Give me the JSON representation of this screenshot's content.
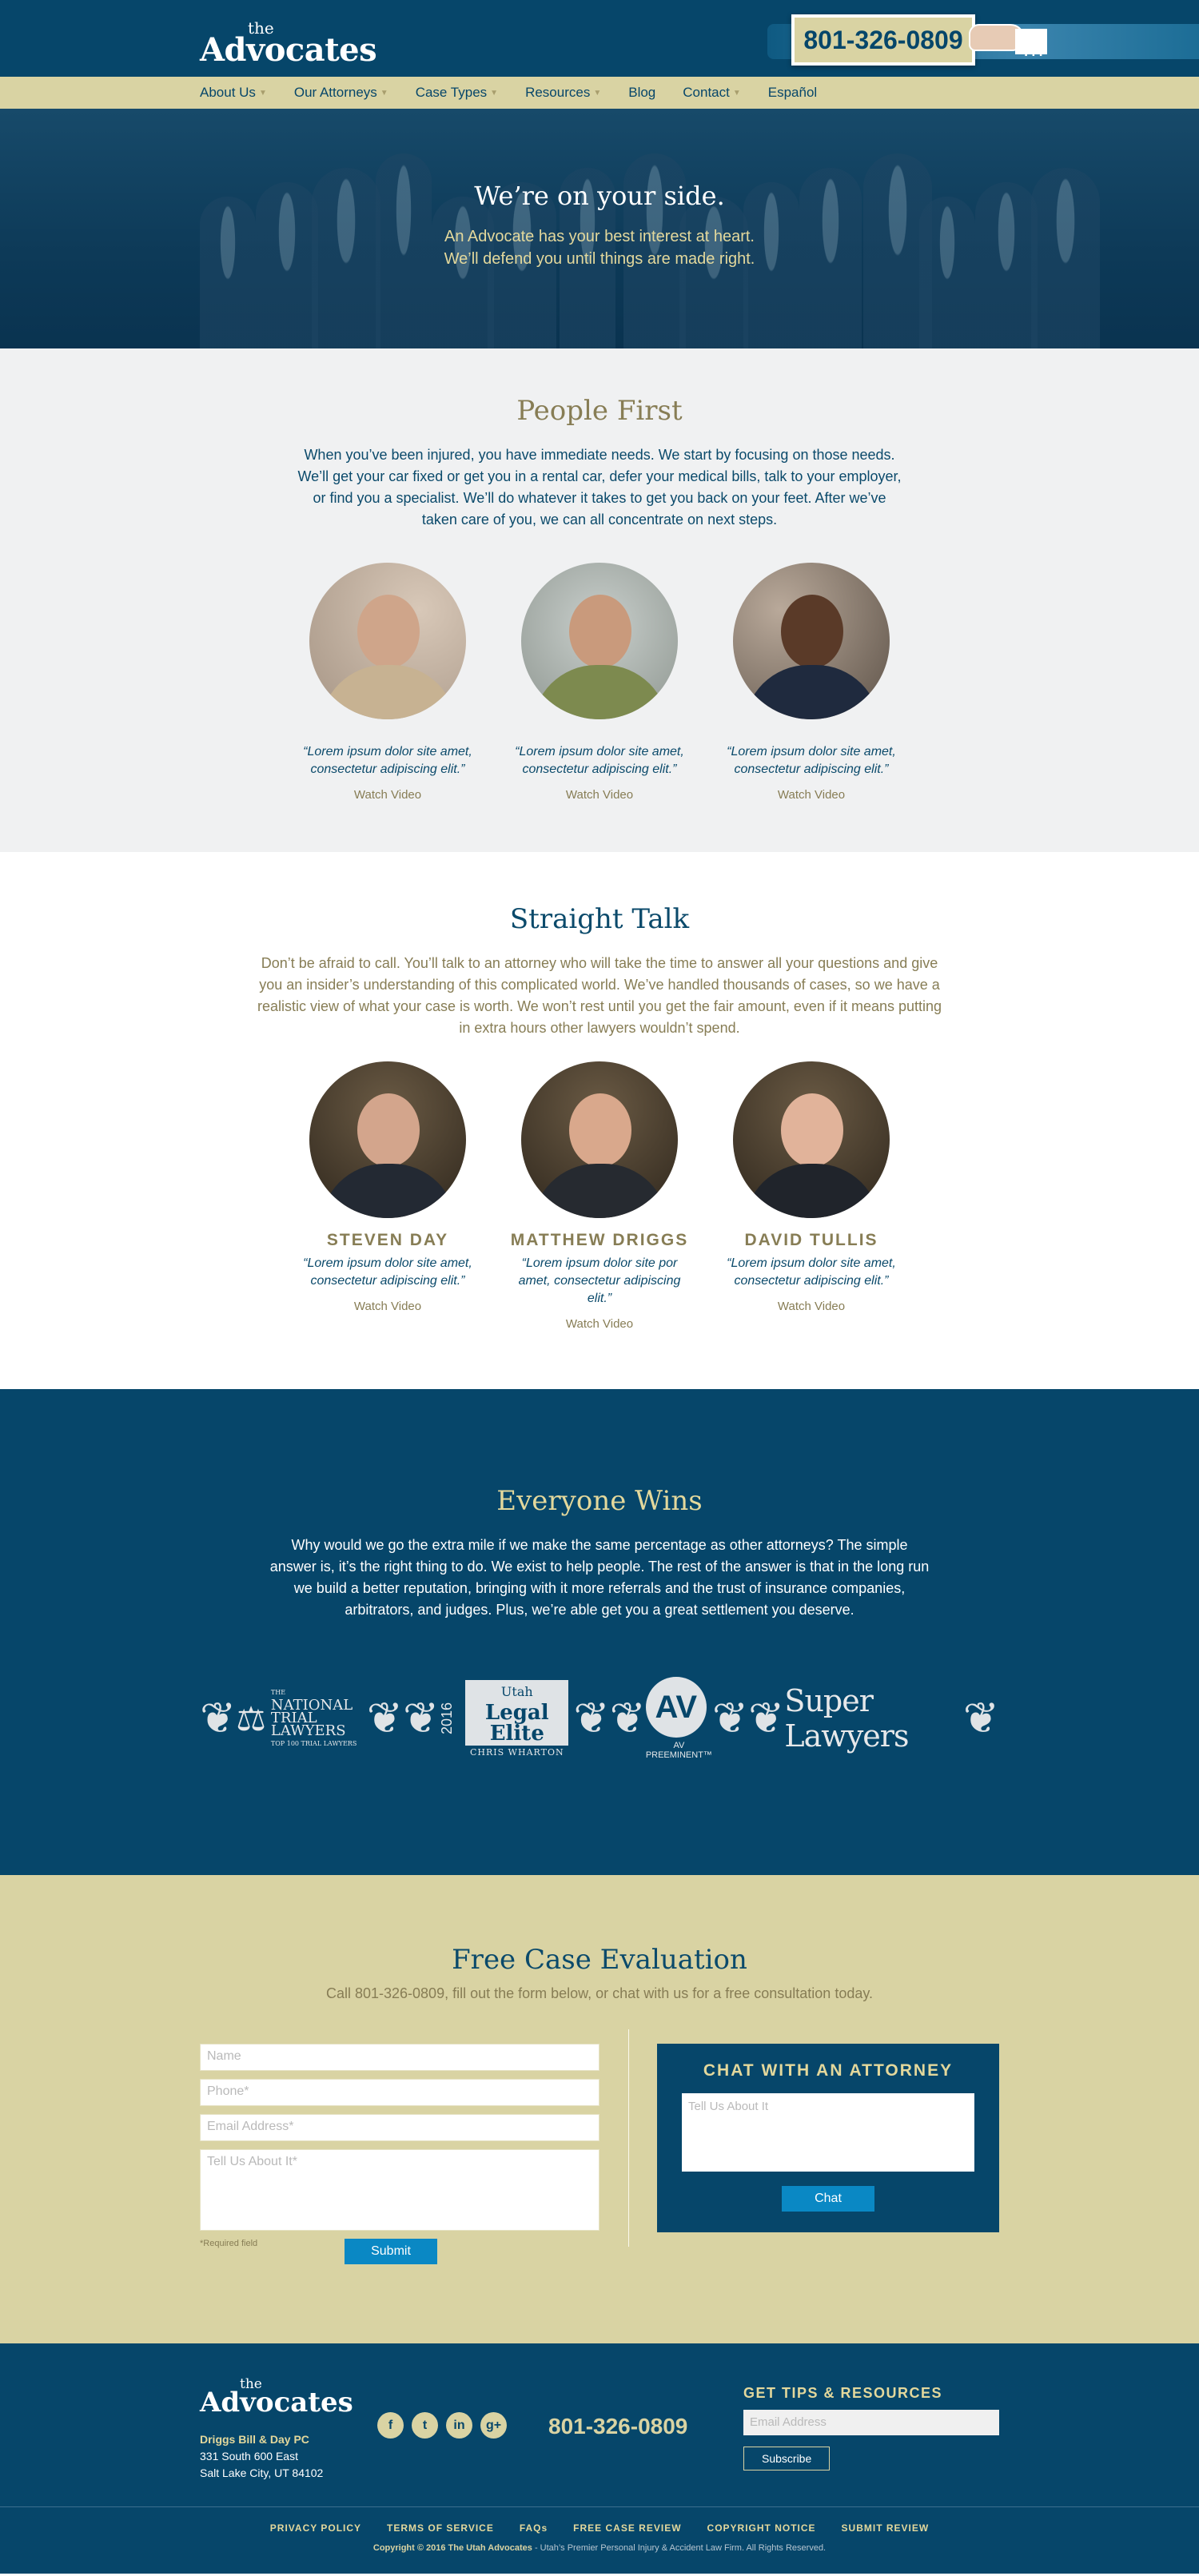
{
  "header": {
    "logo_the": "the",
    "logo_name": "Advocates",
    "phone": "801-326-0809",
    "dots": "..."
  },
  "nav": {
    "items": [
      {
        "label": "About Us",
        "has_dropdown": true
      },
      {
        "label": "Our Attorneys",
        "has_dropdown": true
      },
      {
        "label": "Case Types",
        "has_dropdown": true
      },
      {
        "label": "Resources",
        "has_dropdown": true
      },
      {
        "label": "Blog",
        "has_dropdown": false
      },
      {
        "label": "Contact",
        "has_dropdown": true
      },
      {
        "label": "Español",
        "has_dropdown": false
      }
    ]
  },
  "hero": {
    "title": "We’re on your side.",
    "line1": "An Advocate has your best interest at heart.",
    "line2": "We’ll defend you until things are made right."
  },
  "people_first": {
    "title": "People First",
    "body": "When you’ve been injured, you have immediate needs. We start by focusing on those needs. We’ll get your car fixed or get you in a rental car, defer your medical bills, talk to your employer, or find you a specialist. We’ll do whatever it takes to get you back on your feet. After we’ve taken care of you, we can all concentrate on next steps.",
    "cards": [
      {
        "quote": "“Lorem ipsum dolor site amet, consectetur adipiscing elit.”",
        "link": "Watch Video"
      },
      {
        "quote": "“Lorem ipsum dolor site amet, consectetur adipiscing elit.”",
        "link": "Watch Video"
      },
      {
        "quote": "“Lorem ipsum dolor site amet, consectetur adipiscing elit.”",
        "link": "Watch Video"
      }
    ]
  },
  "straight_talk": {
    "title": "Straight Talk",
    "body": "Don’t be afraid to call. You’ll talk to an attorney who will take the time to answer all your questions and give you an insider’s understanding of this complicated world. We’ve handled thousands of cases, so we have a realistic view of what your case is worth. We won’t rest until you get the fair amount, even if it means putting in extra hours other lawyers wouldn’t spend.",
    "attorneys": [
      {
        "name": "STEVEN DAY",
        "quote": "“Lorem ipsum dolor site amet, consectetur adipiscing elit.”",
        "link": "Watch Video"
      },
      {
        "name": "MATTHEW DRIGGS",
        "quote": "“Lorem ipsum dolor site por amet, consectetur adipiscing elit.”",
        "link": "Watch Video"
      },
      {
        "name": "DAVID TULLIS",
        "quote": "“Lorem ipsum dolor site amet, consectetur adipiscing elit.”",
        "link": "Watch Video"
      }
    ]
  },
  "everyone_wins": {
    "title": "Everyone Wins",
    "body": "Why would we go the extra mile if we make the same percentage as other attorneys? The simple answer is, it’s the right thing to do. We exist to help people. The rest of the answer is that in the long run we build a better reputation, bringing with it more referrals and the trust of insurance companies, arbitrators, and judges. Plus, we’re able get you a great settlement you deserve.",
    "badges": {
      "ntl_the": "THE",
      "ntl_line1": "NATIONAL",
      "ntl_line2": "TRIAL LAWYERS",
      "ntl_sub": "TOP 100 TRIAL LAWYERS",
      "ule_year": "2016",
      "ule_utah": "Utah",
      "ule_title": "Legal Elite",
      "ule_name": "CHRIS WHARTON",
      "av_mark": "AV",
      "av_sub": "AV PREEMINENT™",
      "sl_name": "Super Lawyers"
    }
  },
  "evaluation": {
    "title": "Free Case Evaluation",
    "subtitle": "Call 801-326-0809, fill out the form below, or chat with us for a free consultation today.",
    "name_placeholder": "Name",
    "phone_placeholder": "Phone*",
    "email_placeholder": "Email Address*",
    "message_placeholder": "Tell Us About It*",
    "required_note": "*Required field",
    "submit_label": "Submit",
    "chat_title": "CHAT WITH AN ATTORNEY",
    "chat_placeholder": "Tell Us About It",
    "chat_button": "Chat"
  },
  "footer": {
    "logo_the": "the",
    "logo_name": "Advocates",
    "firm": "Driggs Bill & Day PC",
    "address1": "331 South 600 East",
    "address2": "Salt Lake City, UT 84102",
    "social": [
      "facebook-icon",
      "twitter-icon",
      "linkedin-icon",
      "google-plus-icon"
    ],
    "social_glyphs": [
      "f",
      "t",
      "in",
      "g+"
    ],
    "phone": "801-326-0809",
    "tips_title": "GET TIPS & RESOURCES",
    "email_placeholder": "Email Address",
    "subscribe": "Subscribe",
    "links": [
      "PRIVACY POLICY",
      "TERMS OF SERVICE",
      "FAQs",
      "FREE CASE REVIEW",
      "COPYRIGHT NOTICE",
      "SUBMIT REVIEW"
    ],
    "copyright_bold": "Copyright © 2016 The Utah Advocates",
    "copyright_rest": " - Utah’s Premier Personal Injury & Accident Law Firm. All Rights Reserved."
  },
  "colors": {
    "navy": "#06466a",
    "khaki": "#d9d3a3",
    "gold_text": "#877d55",
    "button_blue": "#0a88c4"
  }
}
